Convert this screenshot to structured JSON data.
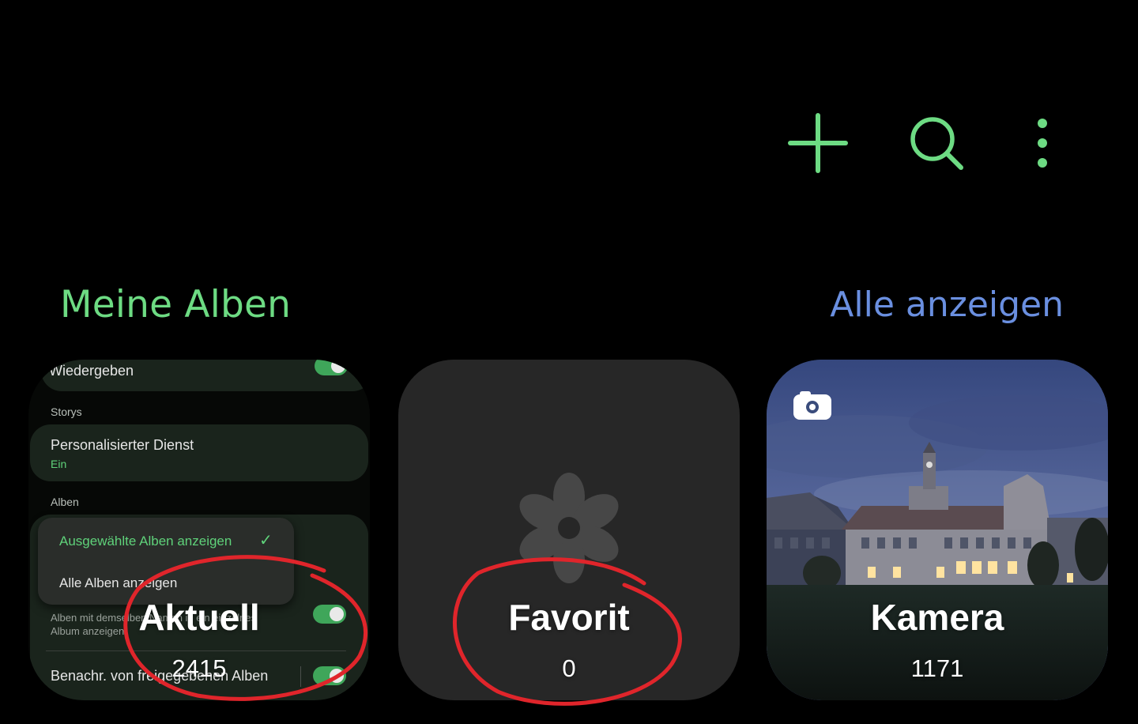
{
  "colors": {
    "accent_green": "#6ddb83",
    "link_blue": "#6a8fe0",
    "annotation_red": "#e0252b",
    "card_bg": "#272727"
  },
  "toolbar": {
    "icons": [
      "plus-icon",
      "search-icon",
      "more-vertical-icon"
    ]
  },
  "section": {
    "title": "Meine Alben",
    "link": "Alle anzeigen"
  },
  "albums": [
    {
      "name": "Aktuell",
      "count": "2415",
      "thumbnail": {
        "row0": "Wiedergeben",
        "heading1": "Storys",
        "row1_title": "Personalisierter Dienst",
        "row1_sub": "Ein",
        "heading2": "Alben",
        "menu_option1": "Ausgewählte Alben anzeigen",
        "menu_option2": "Alle Alben anzeigen",
        "row3_sub": "Alben mit demselben Namen in ein einzelnes Album anzeigen",
        "row4_title": "Benachr. von freigegebenen Alben"
      }
    },
    {
      "name": "Favorit",
      "count": "0",
      "thumbnail_icon": "flower-icon"
    },
    {
      "name": "Kamera",
      "count": "1171",
      "badge_icon": "camera-icon"
    }
  ]
}
